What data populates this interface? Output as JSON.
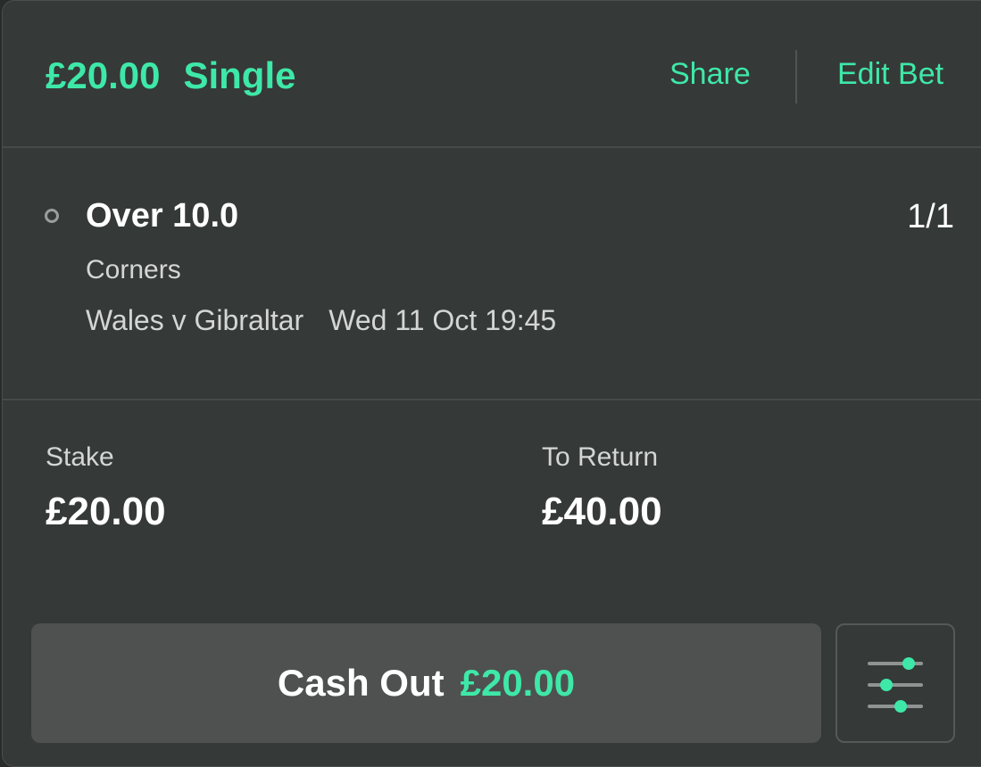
{
  "header": {
    "stake_text": "£20.00",
    "bet_type": "Single",
    "share_label": "Share",
    "edit_label": "Edit Bet"
  },
  "selection": {
    "name": "Over 10.0",
    "odds": "1/1",
    "market": "Corners",
    "event": "Wales v Gibraltar",
    "datetime": "Wed 11 Oct 19:45"
  },
  "summary": {
    "stake_label": "Stake",
    "stake_value": "£20.00",
    "return_label": "To Return",
    "return_value": "£40.00"
  },
  "cashout": {
    "label": "Cash Out",
    "amount": "£20.00"
  },
  "icons": {
    "status": "circle-outline-icon",
    "settings": "sliders-icon"
  },
  "colors": {
    "accent": "#3ee8a8",
    "card": "#353938",
    "button": "#4f5150"
  }
}
